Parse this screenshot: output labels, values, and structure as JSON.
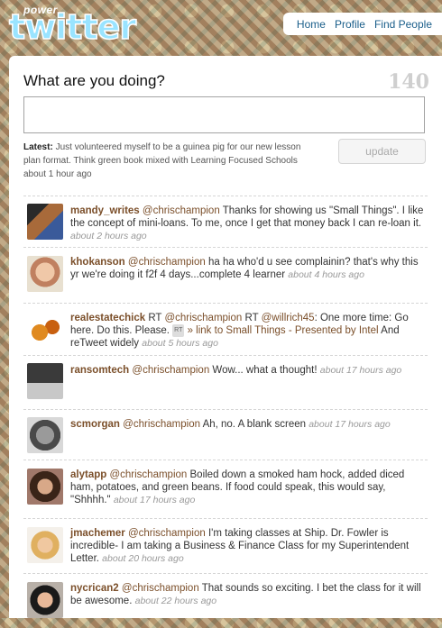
{
  "header": {
    "logo_small": "power",
    "logo_word": "twitter",
    "nav": [
      "Home",
      "Profile",
      "Find People"
    ]
  },
  "compose": {
    "question": "What are you doing?",
    "counter": "140",
    "latest_label": "Latest:",
    "latest_text": "Just volunteered myself to be a guinea pig for our new lesson plan format. Think green book mixed with Learning Focused Schools",
    "latest_time": "about 1 hour ago",
    "update_button": "update"
  },
  "tweets": [
    {
      "user": "mandy_writes",
      "mention": "@chrischampion",
      "text": "Thanks for showing us \"Small Things\". I like the concept of mini-loans. To me, once I get that money back I can re-loan it.",
      "time": "about 2 hours ago"
    },
    {
      "user": "khokanson",
      "mention": "@chrischampion",
      "text": "ha ha who'd u see complainin? that's why this yr we're doing it f2f 4 days...complete 4 learner",
      "time": "about 4 hours ago"
    },
    {
      "user": "realestatechick",
      "pre": "RT",
      "mention": "@chrischampion",
      "mid": "RT",
      "mention2": "@willrich45",
      "text": ": One more time: Go here. Do this. Please.",
      "rt_badge": "RT",
      "link": "» link to Small Things - Presented by Intel",
      "text2": "And reTweet widely",
      "time": "about 5 hours ago"
    },
    {
      "user": "ransomtech",
      "mention": "@chrischampion",
      "text": "Wow... what a thought!",
      "time": "about 17 hours ago"
    },
    {
      "user": "scmorgan",
      "mention": "@chrischampion",
      "text": "Ah, no. A blank screen",
      "time": "about 17 hours ago"
    },
    {
      "user": "alytapp",
      "mention": "@chrischampion",
      "text": "Boiled down a smoked ham hock, added diced ham, potatoes, and green beans. If food could speak, this would say, \"Shhhh.\"",
      "time": "about 17 hours ago"
    },
    {
      "user": "jmachemer",
      "mention": "@chrischampion",
      "text": "I'm taking classes at Ship. Dr. Fowler is incredible- I am taking a Business & Finance Class for my Superintendent Letter.",
      "time": "about 20 hours ago"
    },
    {
      "user": "nycrican2",
      "mention": "@chrischampion",
      "text": "That sounds so exciting. I bet the class for it will be awesome.",
      "time": "about 22 hours ago"
    }
  ]
}
